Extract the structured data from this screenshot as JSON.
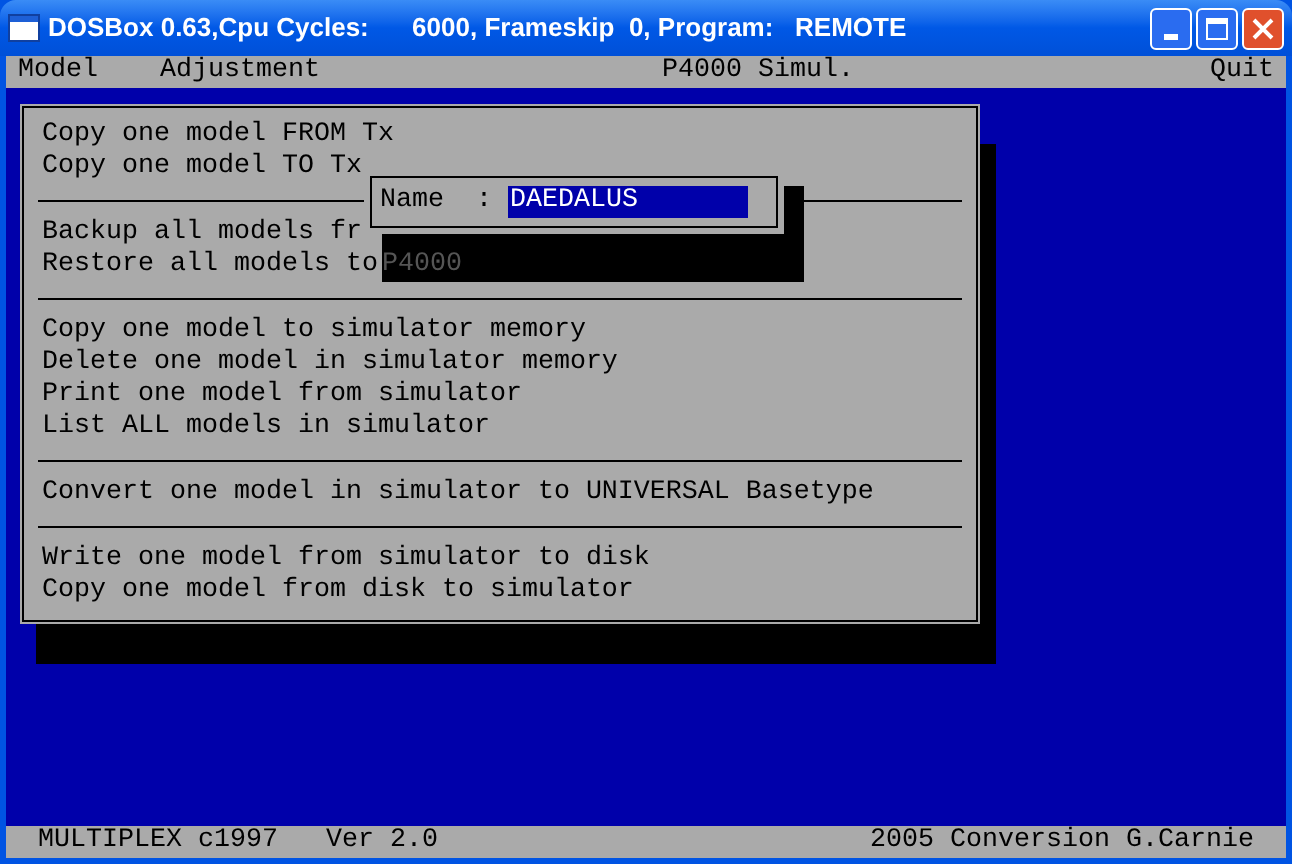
{
  "window": {
    "title": "DOSBox 0.63,Cpu Cycles:      6000, Frameskip  0, Program:   REMOTE"
  },
  "menu_bar": [
    "Model",
    "Adjustment",
    "P4000 Simul.",
    "Quit"
  ],
  "menu_groups": [
    [
      "Copy one model FROM Tx",
      "Copy one model TO Tx"
    ],
    [
      "Backup all models fr",
      "Restore all models to"
    ],
    [
      "Copy one model to simulator memory",
      "Delete one model in simulator memory",
      "Print one model from simulator",
      "List ALL models in simulator"
    ],
    [
      "Convert one model in simulator to UNIVERSAL Basetype"
    ],
    [
      "Write one model from simulator to disk",
      "Copy one model from disk to simulator"
    ]
  ],
  "dialog": {
    "label": "Name  :",
    "value": "DAEDALUS",
    "shadowed_text": "P4000"
  },
  "status_bar": {
    "left": "MULTIPLEX c1997   Ver 2.0",
    "right": "2005 Conversion G.Carnie"
  }
}
